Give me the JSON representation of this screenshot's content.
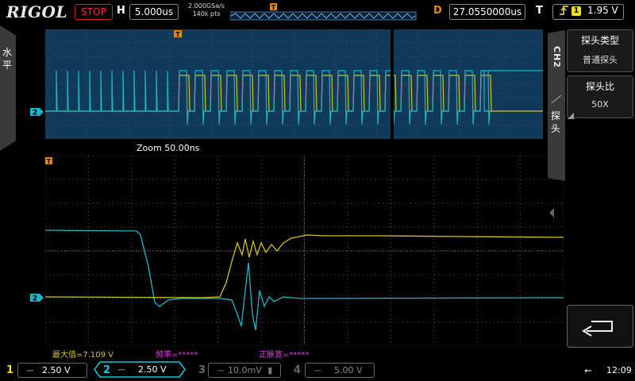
{
  "topbar": {
    "brand": "RIGOL",
    "run_status": "STOP",
    "h_label": "H",
    "timebase": "5.000us",
    "sample_rate": "2.000GSa/s",
    "memory_depth": "140k pts",
    "d_label": "D",
    "delay": "27.0550000us",
    "t_label": "T",
    "trigger_source": "1",
    "trigger_level": "1.95 V",
    "trigger_slope_icon": "rising-edge-icon"
  },
  "left_tab": {
    "label": "水平"
  },
  "zoom_label": "Zoom  50.00ns",
  "channel_markers": {
    "overview_ch2": "2",
    "zoom_ch2": "2"
  },
  "measurements": {
    "max": "最大值=7.109 V",
    "freq": "频率=*****",
    "pulse_width": "正脉宽=*****"
  },
  "right_menu": {
    "channel_tab": "CH2",
    "probe_tab": "探头",
    "items": [
      {
        "title": "探头类型",
        "value": "普通探头"
      },
      {
        "title": "探头比",
        "value": "50X"
      }
    ],
    "enter_icon": "return-arrow-icon"
  },
  "bottombar": {
    "channels": [
      {
        "num": "1",
        "scale": "2.50 V",
        "color": "#f2e21a"
      },
      {
        "num": "2",
        "scale": "2.50 V",
        "color": "#12c6e0"
      },
      {
        "num": "3",
        "scale": "10.0mV",
        "color": "#7a7a7a"
      },
      {
        "num": "4",
        "scale": "5.00 V",
        "color": "#7a7a7a"
      }
    ],
    "usb_icon": "usb-icon",
    "clock": "12:09"
  },
  "colors": {
    "ch1": "#d6c31c",
    "ch2": "#1ab6c8",
    "overview_bg": "#113a58",
    "stop": "#ff2244",
    "delay_marker": "#e48a00"
  }
}
